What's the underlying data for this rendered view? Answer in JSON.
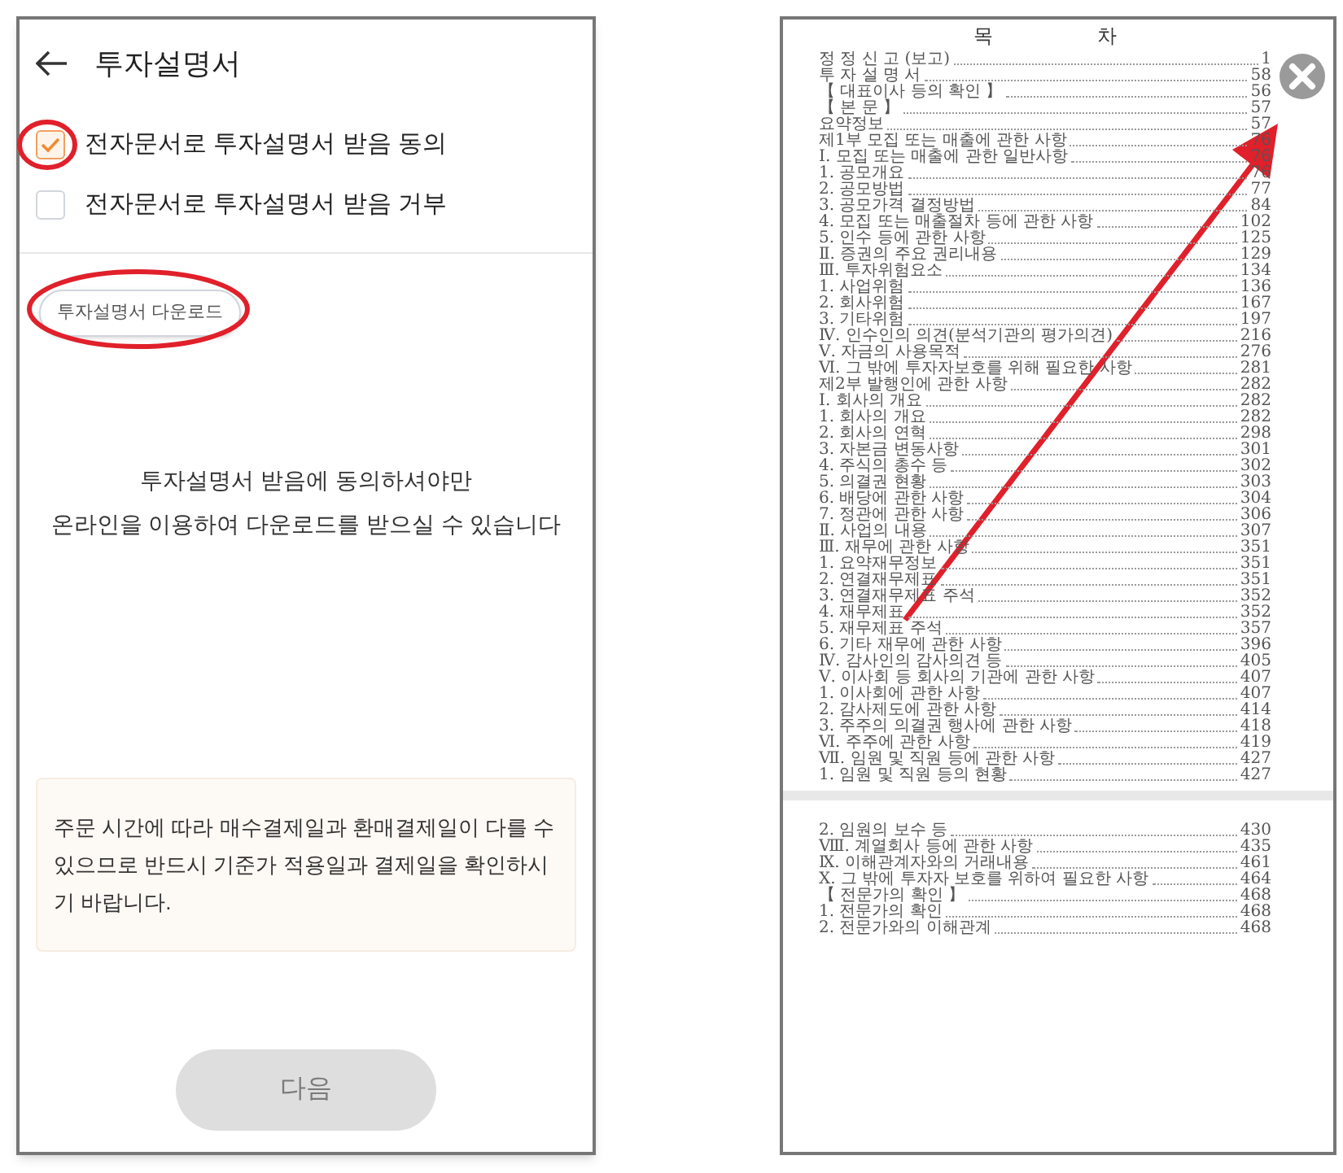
{
  "left_screen": {
    "title": "투자설명서",
    "options": [
      {
        "label": "전자문서로 투자설명서 받음 동의",
        "checked": true
      },
      {
        "label": "전자문서로 투자설명서 받음 거부",
        "checked": false
      }
    ],
    "download_button": "투자설명서 다운로드",
    "message_lines": [
      "투자설명서 받음에 동의하셔야만",
      "온라인을 이용하여 다운로드를 받으실 수 있습니다"
    ],
    "notice": "주문 시간에 따라 매수결제일과 환매결제일이 다를 수 있으므로 반드시 기준가 적용일과 결제일을 확인하시기 바랍니다.",
    "next_button": {
      "label": "다음",
      "disabled": true
    }
  },
  "document": {
    "heading": "목 차",
    "pages": [
      {
        "entries": [
          {
            "title": "정 정 신 고 (보고)",
            "page": "1"
          },
          {
            "title": "투 자 설 명 서",
            "page": "58"
          },
          {
            "title": "【 대표이사 등의 확인 】",
            "page": "56"
          },
          {
            "title": "【 본 문 】",
            "page": "57"
          },
          {
            "title": "요약정보",
            "page": "57"
          },
          {
            "title": "제1부 모집 또는 매출에 관한 사항",
            "page": "76"
          },
          {
            "title": "Ⅰ. 모집 또는 매출에 관한 일반사항",
            "page": "76"
          },
          {
            "title": "1. 공모개요",
            "page": "76"
          },
          {
            "title": "2. 공모방법",
            "page": "77"
          },
          {
            "title": "3. 공모가격 결정방법",
            "page": "84"
          },
          {
            "title": "4. 모집 또는 매출절차 등에 관한 사항",
            "page": "102"
          },
          {
            "title": "5. 인수 등에 관한 사항",
            "page": "125"
          },
          {
            "title": "Ⅱ. 증권의 주요 권리내용",
            "page": "129"
          },
          {
            "title": "Ⅲ. 투자위험요소",
            "page": "134"
          },
          {
            "title": "1. 사업위험",
            "page": "136"
          },
          {
            "title": "2. 회사위험",
            "page": "167"
          },
          {
            "title": "3. 기타위험",
            "page": "197"
          },
          {
            "title": "Ⅳ. 인수인의 의견(분석기관의 평가의견)",
            "page": "216"
          },
          {
            "title": "Ⅴ. 자금의 사용목적",
            "page": "276"
          },
          {
            "title": "Ⅵ. 그 밖에 투자자보호를 위해 필요한 사항",
            "page": "281"
          },
          {
            "title": "제2부 발행인에 관한 사항",
            "page": "282"
          },
          {
            "title": "Ⅰ. 회사의 개요",
            "page": "282"
          },
          {
            "title": "1. 회사의 개요",
            "page": "282"
          },
          {
            "title": "2. 회사의 연혁",
            "page": "298"
          },
          {
            "title": "3. 자본금 변동사항",
            "page": "301"
          },
          {
            "title": "4. 주식의 총수 등",
            "page": "302"
          },
          {
            "title": "5. 의결권 현황",
            "page": "303"
          },
          {
            "title": "6. 배당에 관한 사항",
            "page": "304"
          },
          {
            "title": "7. 정관에 관한 사항",
            "page": "306"
          },
          {
            "title": "Ⅱ. 사업의 내용",
            "page": "307"
          },
          {
            "title": "Ⅲ. 재무에 관한 사항",
            "page": "351"
          },
          {
            "title": "1. 요약재무정보",
            "page": "351"
          },
          {
            "title": "2. 연결재무제표",
            "page": "351"
          },
          {
            "title": "3. 연결재무제표 주석",
            "page": "352"
          },
          {
            "title": "4. 재무제표",
            "page": "352"
          },
          {
            "title": "5. 재무제표 주석",
            "page": "357"
          },
          {
            "title": "6. 기타 재무에 관한 사항",
            "page": "396"
          },
          {
            "title": "Ⅳ. 감사인의 감사의견 등",
            "page": "405"
          },
          {
            "title": "Ⅴ. 이사회 등 회사의 기관에 관한 사항",
            "page": "407"
          },
          {
            "title": "1. 이사회에 관한 사항",
            "page": "407"
          },
          {
            "title": "2. 감사제도에 관한 사항",
            "page": "414"
          },
          {
            "title": "3. 주주의 의결권 행사에 관한 사항",
            "page": "418"
          },
          {
            "title": "Ⅵ. 주주에 관한 사항",
            "page": "419"
          },
          {
            "title": "Ⅶ. 임원 및 직원 등에 관한 사항",
            "page": "427"
          },
          {
            "title": "1. 임원 및 직원 등의 현황",
            "page": "427"
          }
        ]
      },
      {
        "entries": [
          {
            "title": "2. 임원의 보수 등",
            "page": "430"
          },
          {
            "title": "Ⅷ. 계열회사 등에 관한 사항",
            "page": "435"
          },
          {
            "title": "Ⅸ. 이해관계자와의 거래내용",
            "page": "461"
          },
          {
            "title": "Ⅹ. 그 밖에 투자자 보호를 위하여 필요한 사항",
            "page": "464"
          },
          {
            "title": "【 전문가의 확인 】",
            "page": "468"
          },
          {
            "title": "1. 전문가의 확인",
            "page": "468"
          },
          {
            "title": "2. 전문가와의 이해관계",
            "page": "468"
          }
        ]
      }
    ]
  }
}
